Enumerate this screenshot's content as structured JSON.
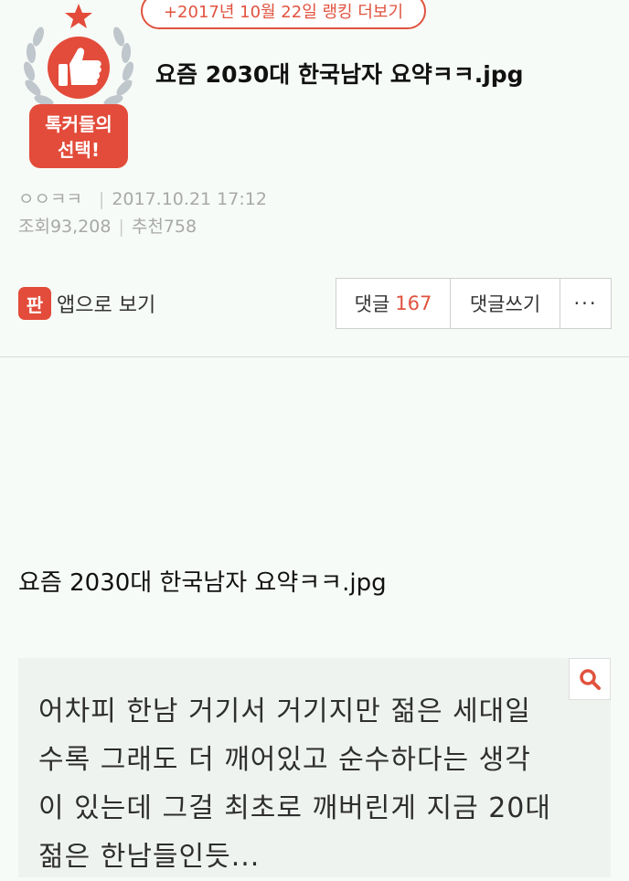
{
  "header": {
    "ranking_link": "+2017년 10월 22일 랭킹 더보기",
    "badge": {
      "line1": "톡커들의",
      "line2": "선택!"
    },
    "title": "요즘 2030대 한국남자 요약ㅋㅋ.jpg"
  },
  "meta": {
    "author": "ㅇㅇㅋㅋ",
    "datetime": "2017.10.21 17:12",
    "views_label": "조회",
    "views": "93,208",
    "recommend_label": "추천",
    "recommend": "758"
  },
  "actions": {
    "app_icon_char": "판",
    "app_view_label": "앱으로 보기",
    "comments_label": "댓글",
    "comments_count": "167",
    "write_comment_label": "댓글쓰기",
    "more_label": "···"
  },
  "content": {
    "title": "요즘 2030대 한국남자 요약ㅋㅋ.jpg",
    "image_lines": [
      "어차피 한남 거기서 거기지만 젊은 세대일",
      "수록 그래도 더 깨어있고 순수하다는 생각",
      "이 있는데 그걸 최초로 깨버린게 지금 20대",
      "젊은 한남들인듯..."
    ]
  },
  "colors": {
    "accent": "#e0533f",
    "badge_red": "#e34b3a",
    "laurel": "#bfc6cc"
  }
}
